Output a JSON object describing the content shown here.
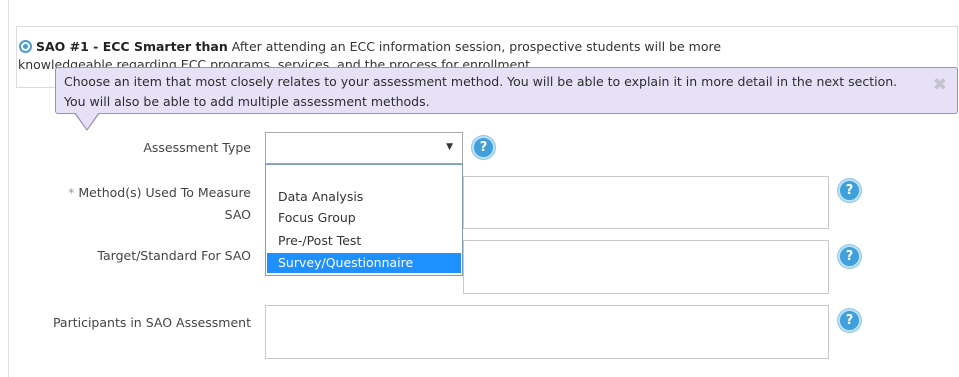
{
  "sao": {
    "title": "SAO #1 - ECC Smarter than",
    "description": "After attending an ECC information session, prospective students will be more",
    "description_cont": "knowledgeable regarding ECC programs, services, and the process for enrollment."
  },
  "tooltip": {
    "text": "Choose an item that most closely relates to your assessment method. You will be able to explain it in more detail in the next section. You will also be able to add multiple assessment methods.",
    "close_glyph": "✖"
  },
  "form": {
    "assessment_type": {
      "label": "Assessment Type",
      "value": "",
      "caret": "▼",
      "options": [
        "Data Analysis",
        "Focus Group",
        "Pre-/Post Test",
        "Survey/Questionnaire"
      ],
      "highlighted": "Survey/Questionnaire"
    },
    "method": {
      "required_mark": "*",
      "label_line1": "Method(s) Used To Measure",
      "label_line2": "SAO",
      "value": ""
    },
    "target": {
      "label": "Target/Standard For SAO",
      "value": ""
    },
    "participants": {
      "label": "Participants in SAO Assessment",
      "value": ""
    },
    "help_glyph": "?"
  },
  "colors": {
    "tooltip_bg": "#e7e1f7",
    "help_blue": "#3fa0db",
    "selected_option": "#1e90ff"
  }
}
